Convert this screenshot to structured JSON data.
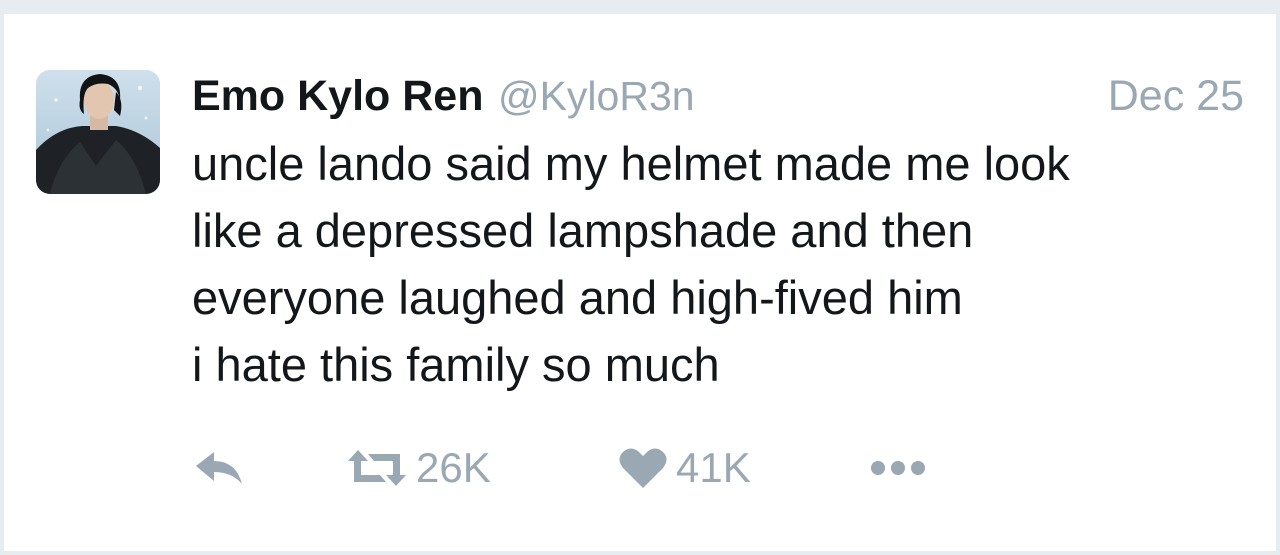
{
  "tweet": {
    "display_name": "Emo Kylo Ren",
    "handle": "@KyloR3n",
    "date": "Dec 25",
    "text_lines": [
      "uncle lando said my helmet made me look",
      "like a depressed lampshade and then",
      "everyone laughed and high-fived him",
      "i hate this family so much"
    ],
    "actions": {
      "reply_icon": "reply-arrow",
      "retweet_icon": "retweet-arrows",
      "retweet_count": "26K",
      "like_icon": "heart",
      "like_count": "41K",
      "more_icon": "three-dots"
    }
  },
  "colors": {
    "text": "#14171a",
    "muted": "#9aa8b3",
    "border": "#e6ecf0"
  }
}
